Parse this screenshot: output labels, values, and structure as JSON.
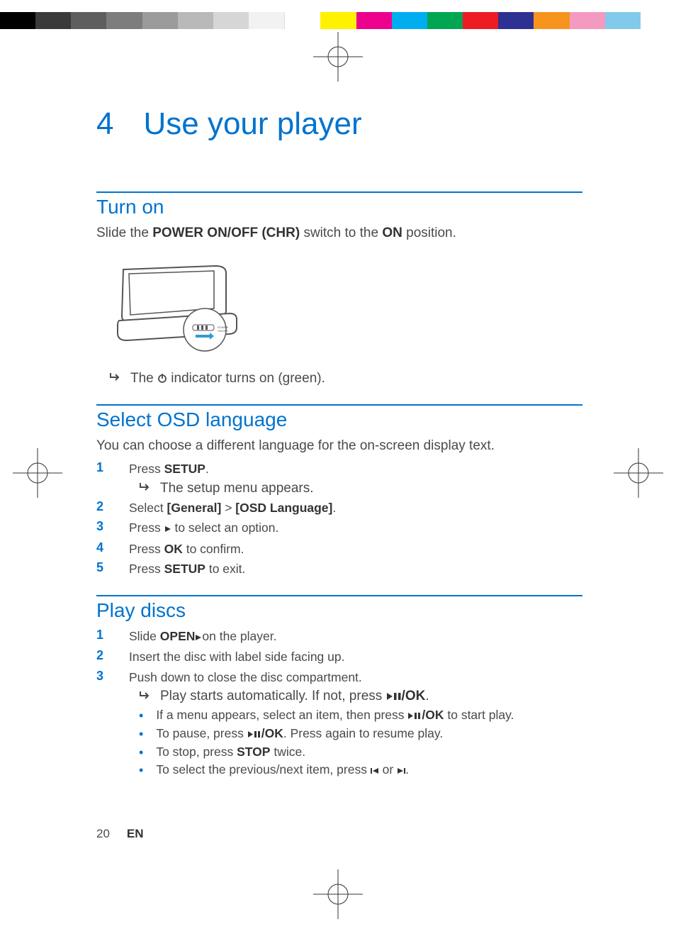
{
  "chapter": {
    "num": "4",
    "title": "Use your player"
  },
  "turn_on": {
    "heading": "Turn on",
    "intro_pre": "Slide the ",
    "intro_bold1": "POWER ON/OFF (CHR)",
    "intro_mid": " switch to the ",
    "intro_bold2": "ON",
    "intro_post": " position.",
    "result_pre": "The ",
    "result_post": " indicator turns on (green)."
  },
  "osd": {
    "heading": "Select OSD language",
    "intro": "You can choose a different language for the on-screen display text.",
    "s1_pre": "Press ",
    "s1_bold": "SETUP",
    "s1_post": ".",
    "s1_result": "The setup menu appears.",
    "s2_pre": "Select ",
    "s2_b1": "[General]",
    "s2_gt": " > ",
    "s2_b2": "[OSD Language]",
    "s2_post": ".",
    "s3_pre": "Press ",
    "s3_post": " to select an option.",
    "s4_pre": "Press ",
    "s4_bold": "OK",
    "s4_post": " to confirm.",
    "s5_pre": "Press ",
    "s5_bold": "SETUP",
    "s5_post": " to exit."
  },
  "play": {
    "heading": "Play discs",
    "s1_pre": "Slide ",
    "s1_bold": "OPEN",
    "s1_post": "on the player.",
    "s2": "Insert the disc with label side facing up.",
    "s3": "Push down to close the disc compartment.",
    "s3_result_pre": "Play starts automatically. If not, press ",
    "s3_result_bold": "/OK",
    "s3_result_post": ".",
    "b1_pre": "If a menu appears, select an item, then press ",
    "b1_bold": "/OK",
    "b1_post": " to start play.",
    "b2_pre": "To pause, press ",
    "b2_bold": "/OK",
    "b2_post": ". Press again to resume play.",
    "b3_pre": "To stop, press ",
    "b3_bold": "STOP",
    "b3_post": " twice.",
    "b4_pre": "To select the previous/next item, press ",
    "b4_mid": " or ",
    "b4_post": "."
  },
  "nums": {
    "n1": "1",
    "n2": "2",
    "n3": "3",
    "n4": "4",
    "n5": "5"
  },
  "footer": {
    "page": "20",
    "lang": "EN"
  },
  "colors": [
    "#000",
    "#333",
    "#666",
    "#888",
    "#aaa",
    "#ccc",
    "#eee",
    "#fff",
    "#fff200",
    "#ec008c",
    "#00aeef",
    "#00a651",
    "#ed1c24",
    "#2e3192",
    "#f7941d",
    "#f49ac1",
    "#82caec",
    "#fff",
    "#fff"
  ]
}
